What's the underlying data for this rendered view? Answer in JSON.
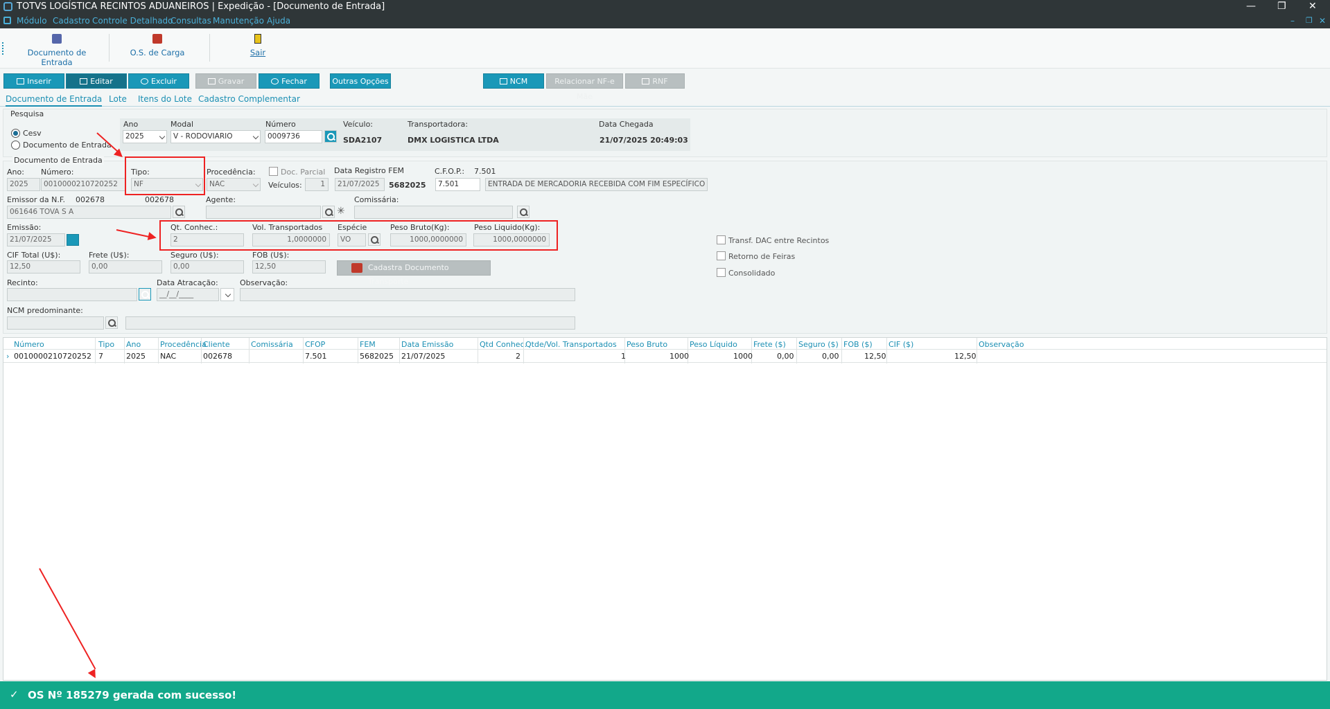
{
  "window": {
    "title": "TOTVS LOGÍSTICA RECINTOS ADUANEIROS | Expedição - [Documento de Entrada]",
    "minimize": "—",
    "restore": "❐",
    "close": "✕"
  },
  "menu": [
    "Módulo",
    "Cadastro",
    "Controle Detalhado",
    "Consultas",
    "Manutenção",
    "Ajuda"
  ],
  "toolbar": {
    "documento_entrada": "Documento de Entrada",
    "os_carga": "O.S. de Carga",
    "sair": "Sair"
  },
  "actions": {
    "inserir": "Inserir",
    "editar": "Editar",
    "excluir": "Excluir",
    "gravar": "Gravar",
    "fechar": "Fechar",
    "outras_opcoes": "Outras Opções",
    "ncm": "NCM",
    "relacionar": "Relacionar NF-e Mãe",
    "rnf": "RNF"
  },
  "tabs": [
    "Documento de Entrada",
    "Lote",
    "Itens do Lote",
    "Cadastro Complementar"
  ],
  "pesquisa": {
    "legend": "Pesquisa",
    "radio_cesv": "Cesv",
    "radio_doc": "Documento de Entrada",
    "ano_label": "Ano",
    "ano": "2025",
    "modal_label": "Modal",
    "modal": "V - RODOVIARIO",
    "numero_label": "Número",
    "numero": "0009736",
    "veiculo_label": "Veículo:",
    "veiculo": "SDA2107",
    "transportadora_label": "Transportadora:",
    "transportadora": "DMX LOGISTICA LTDA",
    "data_chegada_label": "Data Chegada",
    "data_chegada": "21/07/2025 20:49:03"
  },
  "doc": {
    "legend": "Documento de Entrada",
    "ano_label": "Ano:",
    "ano": "2025",
    "numero_label": "Número:",
    "numero": "0010000210720252",
    "tipo_label": "Tipo:",
    "tipo": "NF",
    "procedencia_label": "Procedência:",
    "procedencia": "NAC",
    "doc_parcial": "Doc. Parcial",
    "veiculos_label": "Veículos:",
    "veiculos": "1",
    "data_registro_label": "Data Registro FEM",
    "data_registro": "21/07/2025",
    "fem": "5682025",
    "cfop_label": "C.F.O.P.:",
    "cfop_top": "7.501",
    "cfop": "7.501",
    "cfop_desc": "ENTRADA DE MERCADORIA RECEBIDA COM FIM ESPECÍFICO DE",
    "emissor_label": "Emissor da N.F.",
    "emissor_code1": "002678",
    "emissor_code2": "002678",
    "emissor": "061646  TOVA S A",
    "agente_label": "Agente:",
    "comissaria_label": "Comissária:",
    "emissao_label": "Emissão:",
    "emissao": "21/07/2025",
    "qt_conhec_label": "Qt. Conhec.:",
    "qt_conhec": "2",
    "vol_label": "Vol. Transportados",
    "vol": "1,0000000",
    "especie_label": "Espécie",
    "especie": "VO",
    "peso_bruto_label": "Peso Bruto(Kg):",
    "peso_bruto": "1000,0000000",
    "peso_liquido_label": "Peso Liquido(Kg):",
    "peso_liquido": "1000,0000000",
    "transf_dac": "Transf. DAC entre Recintos",
    "retorno_feiras": "Retorno de Feiras",
    "consolidado": "Consolidado",
    "cif_label": "CIF Total (U$):",
    "cif": "12,50",
    "frete_label": "Frete (U$):",
    "frete": "0,00",
    "seguro_label": "Seguro (U$):",
    "seguro": "0,00",
    "fob_label": "FOB (U$):",
    "fob": "12,50",
    "cadastra_doc": "Cadastra Documento Transporte",
    "recinto_label": "Recinto:",
    "data_atracacao_label": "Data Atracação:",
    "data_atracacao": "__/__/____",
    "observacao_label": "Observação:",
    "ncm_label": "NCM predominante:"
  },
  "grid": {
    "headers": [
      "Número",
      "Tipo",
      "Ano",
      "Procedência",
      "Cliente",
      "Comissária",
      "CFOP",
      "FEM",
      "Data Emissão",
      "Qtd Conhec.",
      "Qtde/Vol. Transportados",
      "Peso Bruto",
      "Peso Líquido",
      "Frete ($)",
      "Seguro ($)",
      "FOB ($)",
      "CIF ($)",
      "Observação"
    ],
    "row": [
      "0010000210720252",
      "7",
      "2025",
      "NAC",
      "002678",
      "",
      "7.501",
      "5682025",
      "21/07/2025",
      "2",
      "1",
      "1000",
      "1000",
      "0,00",
      "0,00",
      "12,50",
      "12,50",
      ""
    ]
  },
  "status": {
    "message": "OS Nº 185279 gerada com sucesso!"
  }
}
